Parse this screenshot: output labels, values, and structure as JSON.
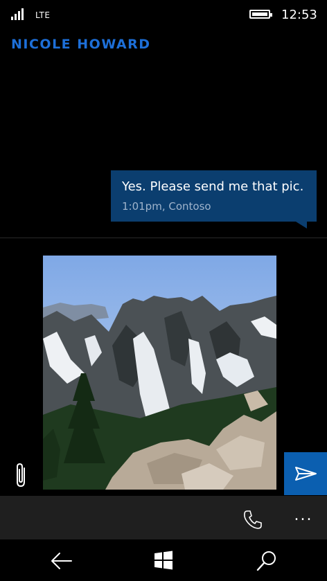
{
  "status_bar": {
    "network": "LTE",
    "time": "12:53",
    "signal_icon": "signal-bars-icon",
    "battery_icon": "battery-full-icon"
  },
  "conversation": {
    "contact_name": "NICOLE HOWARD",
    "messages": [
      {
        "text": "Yes. Please send me that pic.",
        "meta": "1:01pm, Contoso",
        "direction": "incoming",
        "bubble_color": "#0b3e6f"
      }
    ]
  },
  "compose": {
    "attachment": {
      "type": "photo",
      "description_icon": "mountain-photo"
    },
    "attach_icon": "paperclip-icon",
    "send_icon": "send-icon",
    "send_color": "#0b5fb0"
  },
  "app_bar": {
    "call_icon": "phone-icon",
    "more_label": "...",
    "background": "#1f1f1f"
  },
  "nav_bar": {
    "back_icon": "back-arrow-icon",
    "home_icon": "windows-logo-icon",
    "search_icon": "search-icon"
  },
  "colors": {
    "accent": "#1d6fd8",
    "background": "#000000"
  }
}
